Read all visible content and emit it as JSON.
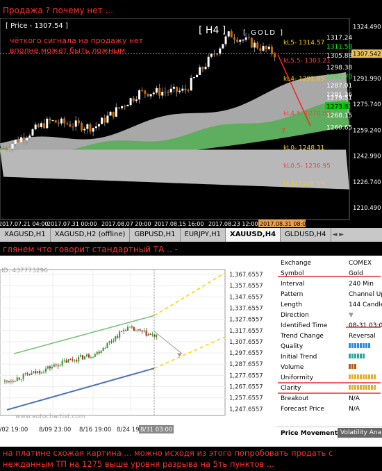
{
  "captions": {
    "top": "Продажа ? почему нет ...",
    "middle": "глянем что говорит стандартный ТА .. -",
    "bottom": "на платине схожая картина ... можно исходя из этого попробовать продать с нежданным ТП на 1275 выше уровня разрыва на 5ть пунктов ..."
  },
  "mt4": {
    "price_label": "[ Price - 1307.54 ]",
    "timeframe": "[ H4 ]",
    "symbol_label": "[ GOLD ]",
    "note_line1": "чёткого сигнала на продажу нет",
    "note_line2": "вполне может быть ложным",
    "current_price": "1307.542",
    "question_mark": "?",
    "y_ticks": [
      "1324.490",
      "1307.542",
      "1291.990",
      "1275.740",
      "1259.240",
      "1242.990",
      "1226.740",
      "1210.490"
    ],
    "x_ticks": [
      "2017.07.21 04:00",
      "2017.07.31 00:00",
      "2017.08.07 20:00",
      "2017.08.15 16:00",
      "2017.08.23 12:00",
      "2017.08.31 08:00"
    ],
    "levels": [
      {
        "label": "kL5- 1314.57",
        "color": "#ffcc00"
      },
      {
        "label": "kL5.5- 1303.21",
        "color": "#ff4040"
      },
      {
        "label": "kL4- 1291.85",
        "color": "#ffcc00"
      },
      {
        "label": "kL4.5- 1270.08",
        "color": "#ff4040"
      },
      {
        "label": "kL0- 1248.31",
        "color": "#ffcc00"
      },
      {
        "label": "kL0.5- 1236.95",
        "color": "#ff4040"
      },
      {
        "label": "kL1- 1225.59",
        "color": "#ffcc00"
      }
    ],
    "right_values": [
      {
        "v": "1317.24",
        "color": "#ffffff",
        "bg": ""
      },
      {
        "v": "1311.58",
        "color": "#00ff00",
        "bg": ""
      },
      {
        "v": "1305.88",
        "color": "#ffffff",
        "bg": ""
      },
      {
        "v": "1298.38",
        "color": "#ffffff",
        "bg": ""
      },
      {
        "v": "1292.70",
        "color": "#00ff00",
        "bg": ""
      },
      {
        "v": "1287.01",
        "color": "#ffffff",
        "bg": ""
      },
      {
        "v": "1281.36",
        "color": "#ffffff",
        "bg": ""
      },
      {
        "v": "1279.51",
        "color": "#ffffff",
        "bg": ""
      },
      {
        "v": "1273.83",
        "color": "#000000",
        "bg": "#00cc00"
      },
      {
        "v": "1268.15",
        "color": "#ffffff",
        "bg": ""
      },
      {
        "v": "1260.65",
        "color": "#ffffff",
        "bg": ""
      }
    ]
  },
  "tabs": [
    "XAGUSD,H1",
    "XAGUSD,H2 (offline)",
    "GBPUSD,H1",
    "EURJPY,H1",
    "XAUUSD,H4",
    "GLDUSD,H4"
  ],
  "tab_nav": "◄ ►",
  "autochartist": {
    "id_text": "ID: 437773296",
    "watermark": "www.autochartist.com",
    "y_ticks": [
      "1,367.6557",
      "1,357.6557",
      "1,347.6557",
      "1,337.6557",
      "1,327.6557",
      "1,317.6557",
      "1,307.6557",
      "1,297.6557",
      "1,287.6557",
      "1,277.6557",
      "1,267.6557",
      "1,257.6557",
      "1,247.6557"
    ],
    "x_ticks": [
      "8/02 19:00",
      "8/09 23:00",
      "8/16 19:00",
      "8/24 19:00",
      "8/31 03:00"
    ]
  },
  "pattern_info": [
    {
      "k": "Exchange",
      "v": "COMEX",
      "type": "text"
    },
    {
      "k": "Symbol",
      "v": "Gold",
      "type": "text"
    },
    {
      "k": "Interval",
      "v": "240 Min",
      "type": "text"
    },
    {
      "k": "Pattern",
      "v": "Channel Up",
      "type": "text"
    },
    {
      "k": "Length",
      "v": "144 Candles",
      "type": "text"
    },
    {
      "k": "Direction",
      "v": "▼",
      "type": "text"
    },
    {
      "k": "Identified Time",
      "v": "08-31 03:00",
      "type": "text"
    },
    {
      "k": "Trend Change",
      "v": "Reversal",
      "type": "text"
    },
    {
      "k": "Quality",
      "v": "",
      "type": "bars",
      "count": 8,
      "color": "#2a8fe0"
    },
    {
      "k": "Initial Trend",
      "v": "",
      "type": "bars",
      "count": 6,
      "color": "#2aa8a0"
    },
    {
      "k": "Volume",
      "v": "",
      "type": "bars",
      "count": 3,
      "color": "#b05a20"
    },
    {
      "k": "Uniformity",
      "v": "",
      "type": "bars",
      "count": 10,
      "color": "#e0b030"
    },
    {
      "k": "Clarity",
      "v": "",
      "type": "bars",
      "count": 10,
      "color": "#e0b030"
    },
    {
      "k": "Breakout",
      "v": "N/A",
      "type": "text"
    },
    {
      "k": "Forecast Price",
      "v": "N/A",
      "type": "text"
    }
  ],
  "footer": {
    "price_movement": "Price Movement",
    "volatility": "Volatility Ana"
  },
  "chart_data": [
    {
      "type": "candlestick",
      "title": "GOLD H4",
      "x": [
        "2017.07.21 04:00",
        "2017.07.31 00:00",
        "2017.08.07 20:00",
        "2017.08.15 16:00",
        "2017.08.23 12:00",
        "2017.08.31 08:00"
      ],
      "close_approx": [
        1248,
        1265,
        1261,
        1283,
        1284,
        1320,
        1307.54
      ],
      "ylim": [
        1203,
        1330
      ],
      "cloud": "ichimoku",
      "levels": {
        "kL5": 1314.57,
        "kL5.5": 1303.21,
        "kL4": 1291.85,
        "kL4.5": 1270.08,
        "kL0": 1248.31,
        "kL0.5": 1236.95,
        "kL1": 1225.59
      }
    },
    {
      "type": "candlestick",
      "title": "COMEX Gold 240 Min",
      "pattern": "Channel Up",
      "x": [
        "8/02 19:00",
        "8/09 23:00",
        "8/16 19:00",
        "8/24 19:00",
        "8/31 03:00"
      ],
      "close_approx": [
        1272,
        1280,
        1290,
        1297,
        1320,
        1312
      ],
      "ylim": [
        1242,
        1370
      ],
      "channel_upper": [
        [
          0,
          1297
        ],
        [
          1,
          1330
        ]
      ],
      "channel_lower": [
        [
          0,
          1248
        ],
        [
          1,
          1285
        ]
      ]
    }
  ]
}
